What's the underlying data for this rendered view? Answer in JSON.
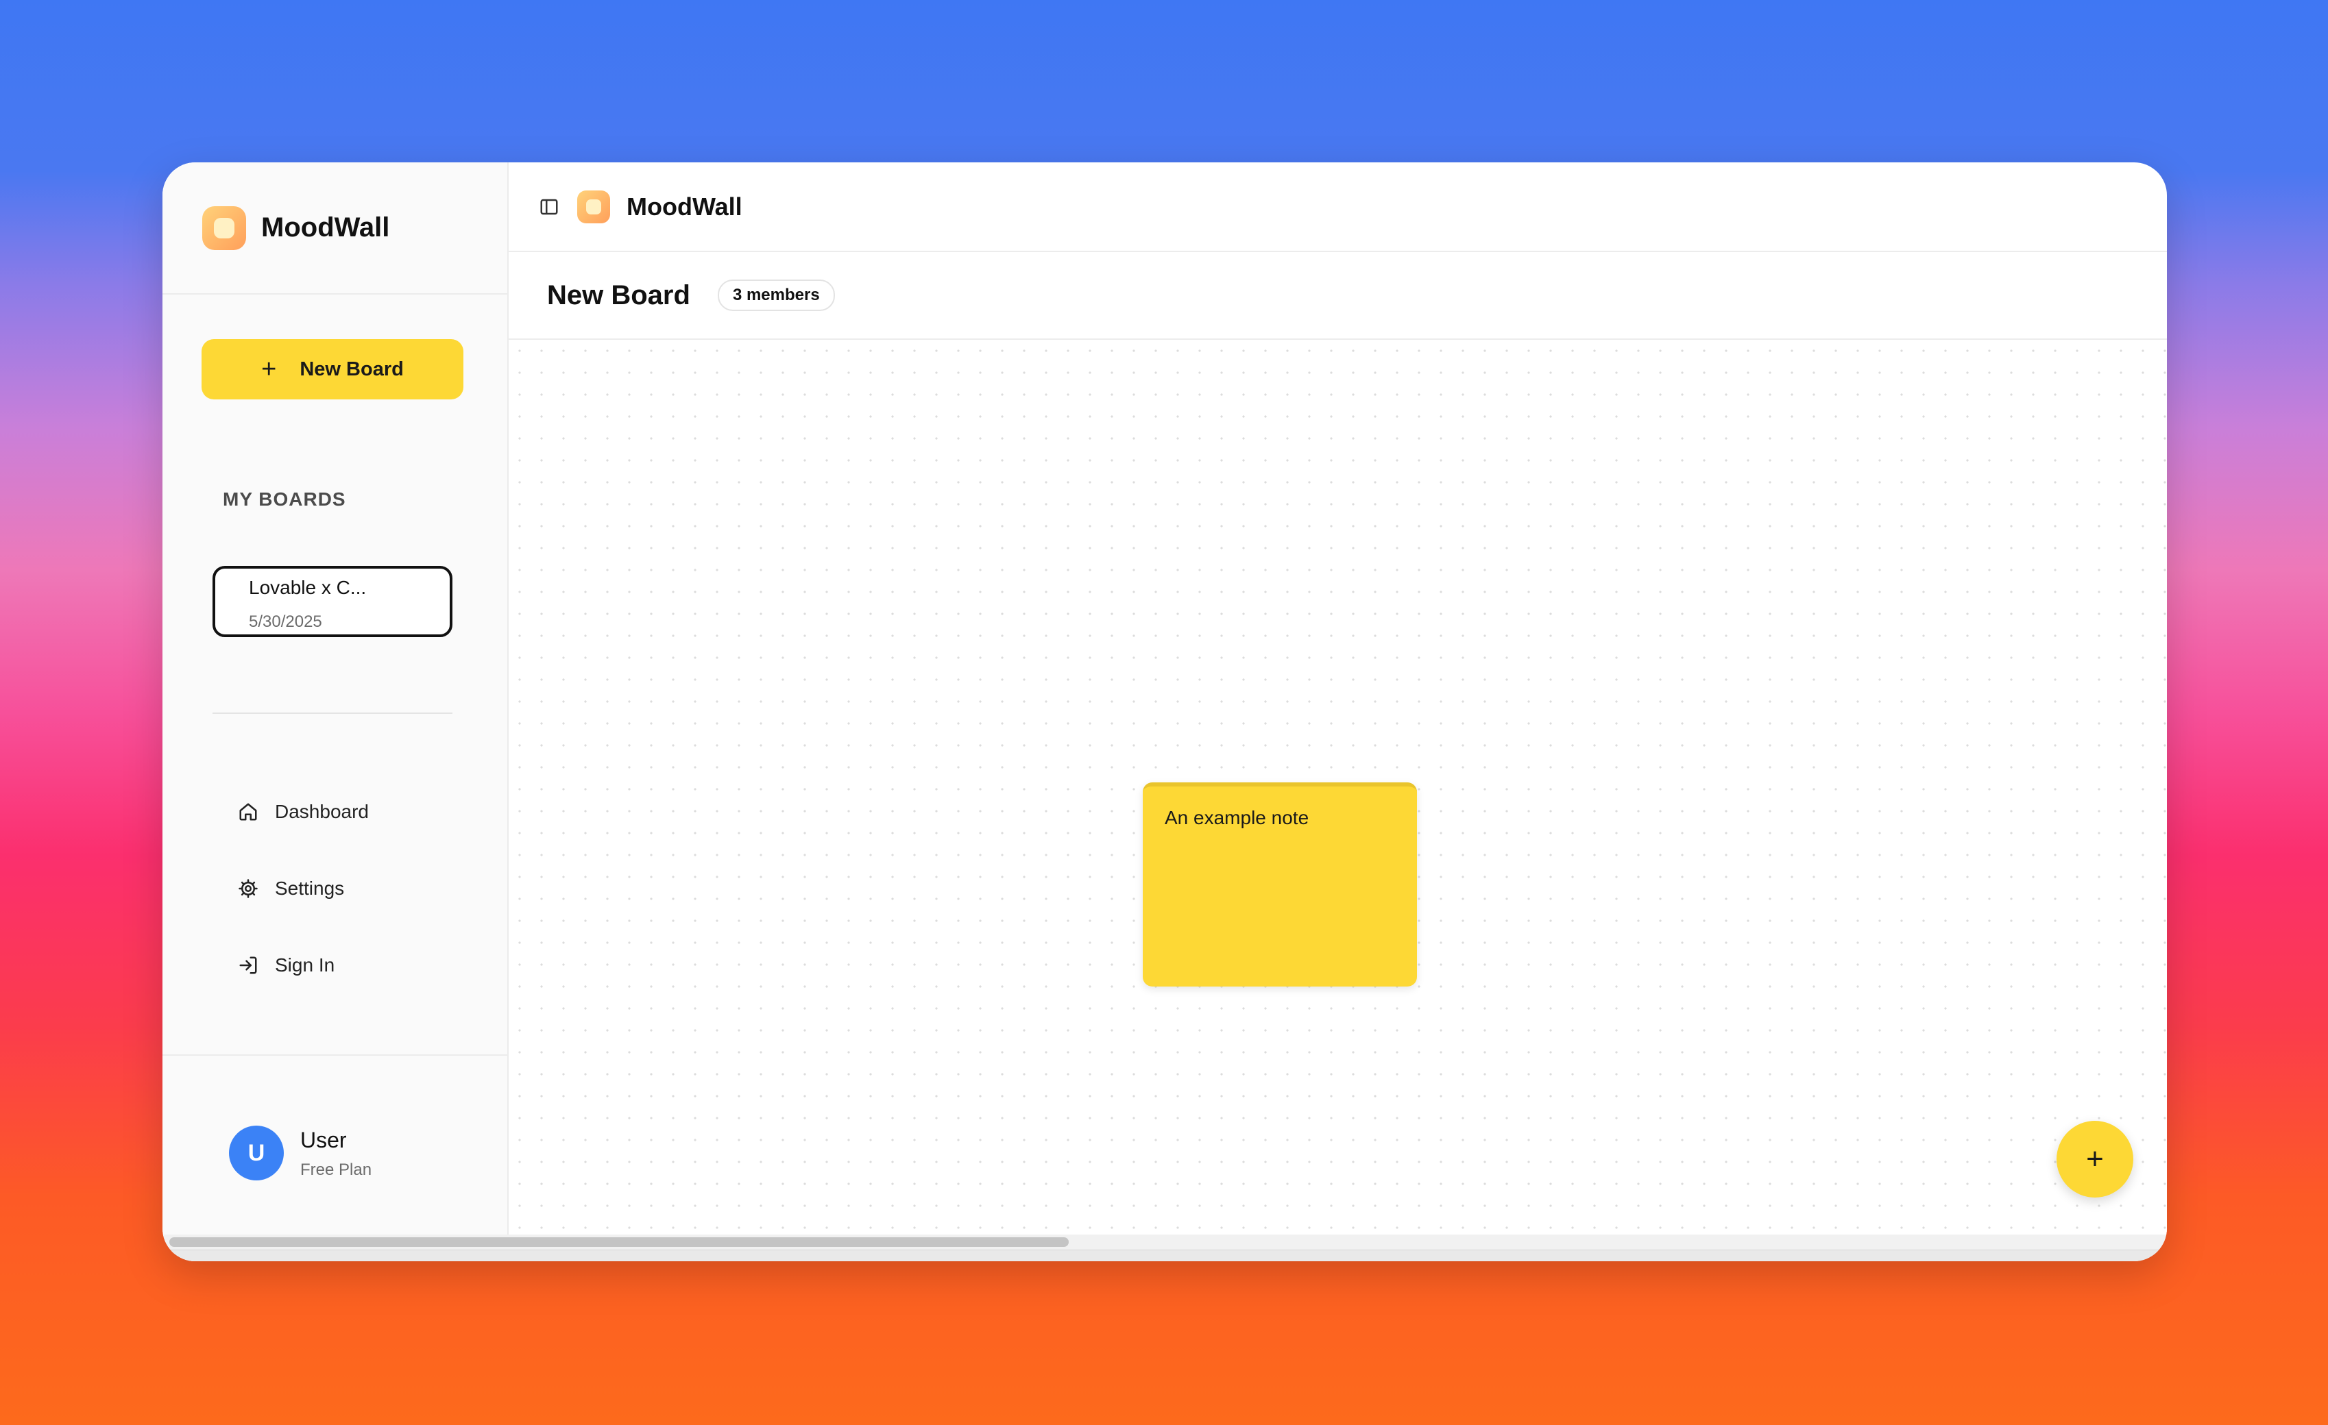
{
  "app": {
    "name": "MoodWall"
  },
  "sidebar": {
    "new_board_label": "New Board",
    "section_label": "MY BOARDS",
    "boards": [
      {
        "name": "Lovable x C...",
        "date": "5/30/2025"
      }
    ],
    "nav": [
      {
        "label": "Dashboard",
        "icon": "home-icon"
      },
      {
        "label": "Settings",
        "icon": "gear-icon"
      },
      {
        "label": "Sign In",
        "icon": "sign-in-icon"
      }
    ],
    "user": {
      "initial": "U",
      "name": "User",
      "plan": "Free Plan"
    }
  },
  "topbar": {
    "title": "MoodWall"
  },
  "board": {
    "title": "New Board",
    "members": "3 members"
  },
  "canvas": {
    "notes": [
      {
        "text": "An example note",
        "color": "#fdd835"
      }
    ]
  },
  "fab": {
    "label": "+"
  },
  "colors": {
    "accent": "#fdd835",
    "avatar": "#3b82f6"
  }
}
